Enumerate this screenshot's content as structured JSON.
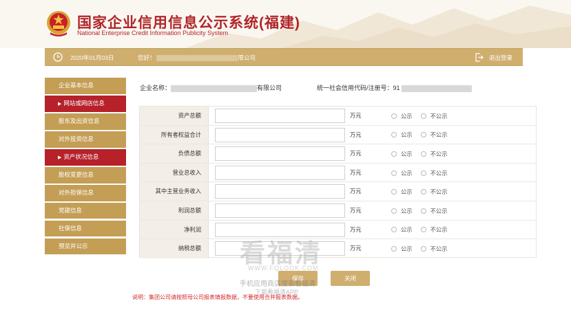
{
  "header": {
    "title_cn": "国家企业信用信息公示系统(福建)",
    "title_en": "National Enterprise Credit Information Publicity System",
    "emblem_icon": "national-emblem-icon"
  },
  "topbar": {
    "date": "2020年01月03日",
    "greeting_prefix": "您好！",
    "greeting_suffix": "限公司",
    "logout_label": "退出登录"
  },
  "sidebar": {
    "items": [
      {
        "label": "企业基本信息",
        "active": false
      },
      {
        "label": "网站或网店信息",
        "active": true
      },
      {
        "label": "股东及出资信息",
        "active": false
      },
      {
        "label": "对外投资信息",
        "active": false
      },
      {
        "label": "资产状况信息",
        "active": true
      },
      {
        "label": "股权变更信息",
        "active": false
      },
      {
        "label": "对外担保信息",
        "active": false
      },
      {
        "label": "党建信息",
        "active": false
      },
      {
        "label": "社保信息",
        "active": false
      },
      {
        "label": "预览并公示",
        "active": false
      }
    ],
    "arrow": "▶"
  },
  "company": {
    "name_label": "企业名称：",
    "name_suffix": "有限公司",
    "uscc_label": "统一社会信用代码/注册号：",
    "uscc_prefix": "91"
  },
  "form": {
    "unit": "万元",
    "publish_label": "公示",
    "not_publish_label": "不公示",
    "rows": [
      {
        "label": "资产总额",
        "value": ""
      },
      {
        "label": "所有者权益合计",
        "value": ""
      },
      {
        "label": "负债总额",
        "value": ""
      },
      {
        "label": "营业总收入",
        "value": ""
      },
      {
        "label": "其中主营业务收入",
        "value": ""
      },
      {
        "label": "利润总额",
        "value": ""
      },
      {
        "label": "净利润",
        "value": ""
      },
      {
        "label": "纳税总额",
        "value": ""
      }
    ]
  },
  "buttons": {
    "save": "保存",
    "close": "关闭"
  },
  "note": "说明：集团公司请按照母公司报表填报数据，不要使用合并报表数据。",
  "watermark": {
    "big": "看福清",
    "url": "WWW.FQLOOK.COM",
    "line1": "手机应用商店搜索看福清",
    "line2": "下载看福清APP"
  },
  "colors": {
    "brand_red": "#b0252a",
    "gold": "#c49e55",
    "active_red": "#b6212a",
    "note_red": "#d12a2a"
  }
}
